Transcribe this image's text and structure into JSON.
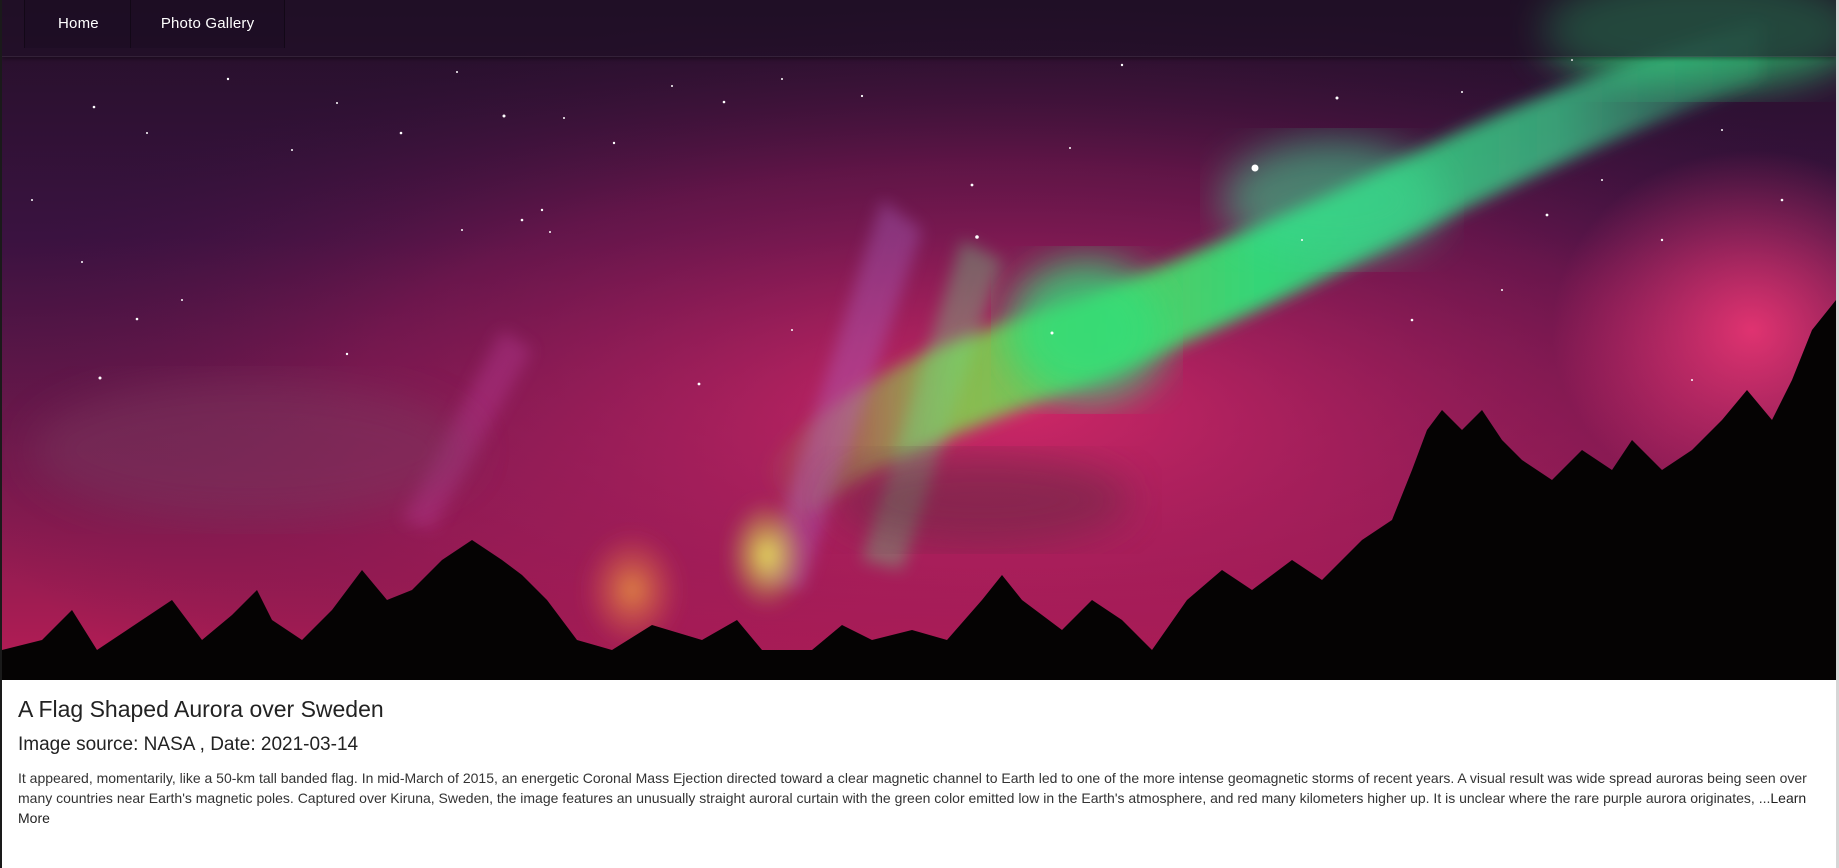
{
  "nav": {
    "items": [
      {
        "label": "Home"
      },
      {
        "label": "Photo Gallery"
      }
    ]
  },
  "photo": {
    "title": "A Flag Shaped Aurora over Sweden",
    "meta": "Image source: NASA , Date: 2021-03-14",
    "description": "It appeared, momentarily, like a 50-km tall banded flag. In mid-March of 2015, an energetic Coronal Mass Ejection directed toward a clear magnetic channel to Earth led to one of the more intense geomagnetic storms of recent years. A visual result was wide spread auroras being seen over many countries near Earth's magnetic poles. Captured over Kiruna, Sweden, the image features an unusually straight auroral curtain with the green color emitted low in the Earth's atmosphere, and red many kilometers higher up. It is unclear where the rare purple aurora originates, ...",
    "learn_more": "Learn More"
  },
  "colors": {
    "sky_dark": "#2a0f2e",
    "aurora_green": "#2fe07a",
    "aurora_magenta": "#d6246e",
    "aurora_yellow": "#e8e050",
    "text": "#222222"
  }
}
